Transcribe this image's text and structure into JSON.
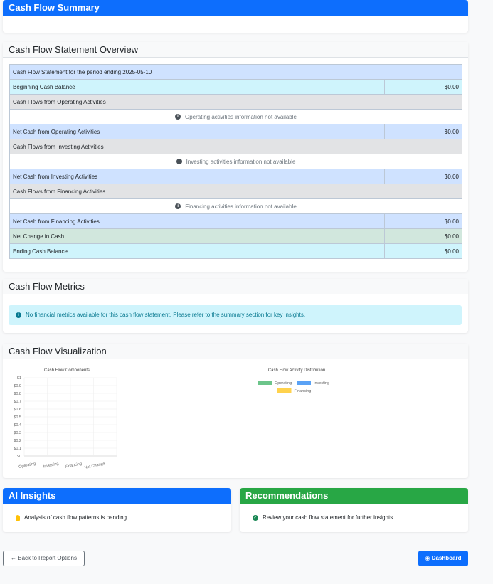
{
  "summary": {
    "title": "Cash Flow Summary"
  },
  "overview": {
    "title": "Cash Flow Statement Overview",
    "rows": {
      "period": "Cash Flow Statement for the period ending 2025-05-10",
      "beginning_label": "Beginning Cash Balance",
      "beginning_value": "$0.00",
      "operating_header": "Cash Flows from Operating Activities",
      "operating_na": "Operating activities information not available",
      "net_operating_label": "Net Cash from Operating Activities",
      "net_operating_value": "$0.00",
      "investing_header": "Cash Flows from Investing Activities",
      "investing_na": "Investing activities information not available",
      "net_investing_label": "Net Cash from Investing Activities",
      "net_investing_value": "$0.00",
      "financing_header": "Cash Flows from Financing Activities",
      "financing_na": "Financing activities information not available",
      "net_financing_label": "Net Cash from Financing Activities",
      "net_financing_value": "$0.00",
      "net_change_label": "Net Change in Cash",
      "net_change_value": "$0.00",
      "ending_label": "Ending Cash Balance",
      "ending_value": "$0.00"
    }
  },
  "metrics": {
    "title": "Cash Flow Metrics",
    "alert": "No financial metrics available for this cash flow statement. Please refer to the summary section for key insights."
  },
  "visualization": {
    "title": "Cash Flow Visualization"
  },
  "chart_data": [
    {
      "type": "bar",
      "title": "Cash Flow Components",
      "categories": [
        "Operating",
        "Investing",
        "Financing",
        "Net Change"
      ],
      "values": [
        0,
        0,
        0,
        0
      ],
      "ylim": [
        0,
        1
      ],
      "y_ticks": [
        "$0",
        "$0.1",
        "$0.2",
        "$0.3",
        "$0.4",
        "$0.5",
        "$0.6",
        "$0.7",
        "$0.8",
        "$0.9",
        "$1"
      ],
      "grid": true
    },
    {
      "type": "pie",
      "title": "Cash Flow Activity Distribution",
      "legend": [
        {
          "name": "Operating",
          "color": "#6cc58a"
        },
        {
          "name": "Investing",
          "color": "#5aa2f5"
        },
        {
          "name": "Financing",
          "color": "#ffd24d"
        }
      ],
      "legend_position": "top"
    }
  ],
  "ai_insights": {
    "title": "AI Insights",
    "text": "Analysis of cash flow patterns is pending."
  },
  "recommendations": {
    "title": "Recommendations",
    "text": "Review your cash flow statement for further insights."
  },
  "buttons": {
    "back": "Back to Report Options",
    "dashboard": "Dashboard"
  },
  "colors": {
    "primary": "#0d6efd",
    "success": "#28a745",
    "info": "#cff4fc"
  }
}
